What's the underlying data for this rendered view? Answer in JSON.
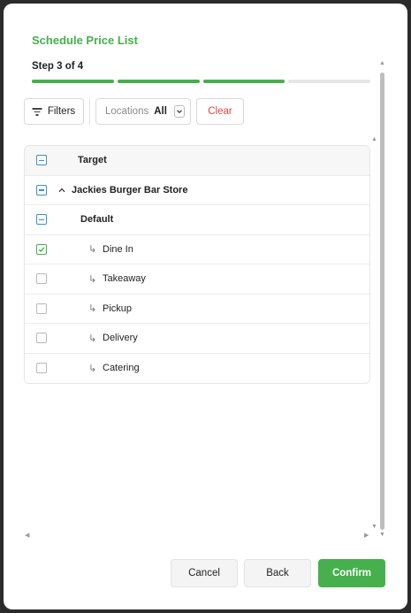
{
  "dialog": {
    "title": "Schedule Price List",
    "step_label": "Step 3 of 4",
    "progress": {
      "current_step": 3,
      "total_steps": 4
    }
  },
  "toolbar": {
    "filters_label": "Filters",
    "locations_label": "Locations",
    "locations_value": "All",
    "clear_label": "Clear"
  },
  "table": {
    "header": {
      "label": "Target",
      "state": "indeterminate"
    },
    "rows": [
      {
        "label": "Jackies Burger Bar Store",
        "state": "indeterminate",
        "expanded": true,
        "bold": true
      },
      {
        "label": "Default",
        "state": "indeterminate",
        "bold": true
      },
      {
        "label": "Dine In",
        "state": "checked",
        "prefix": "↳"
      },
      {
        "label": "Takeaway",
        "state": "unchecked",
        "prefix": "↳"
      },
      {
        "label": "Pickup",
        "state": "unchecked",
        "prefix": "↳"
      },
      {
        "label": "Delivery",
        "state": "unchecked",
        "prefix": "↳"
      },
      {
        "label": "Catering",
        "state": "unchecked",
        "prefix": "↳"
      }
    ]
  },
  "footer": {
    "cancel_label": "Cancel",
    "back_label": "Back",
    "confirm_label": "Confirm"
  },
  "colors": {
    "accent": "#45b04c",
    "indeterminate": "#3a8fd6",
    "danger": "#e0473d"
  }
}
